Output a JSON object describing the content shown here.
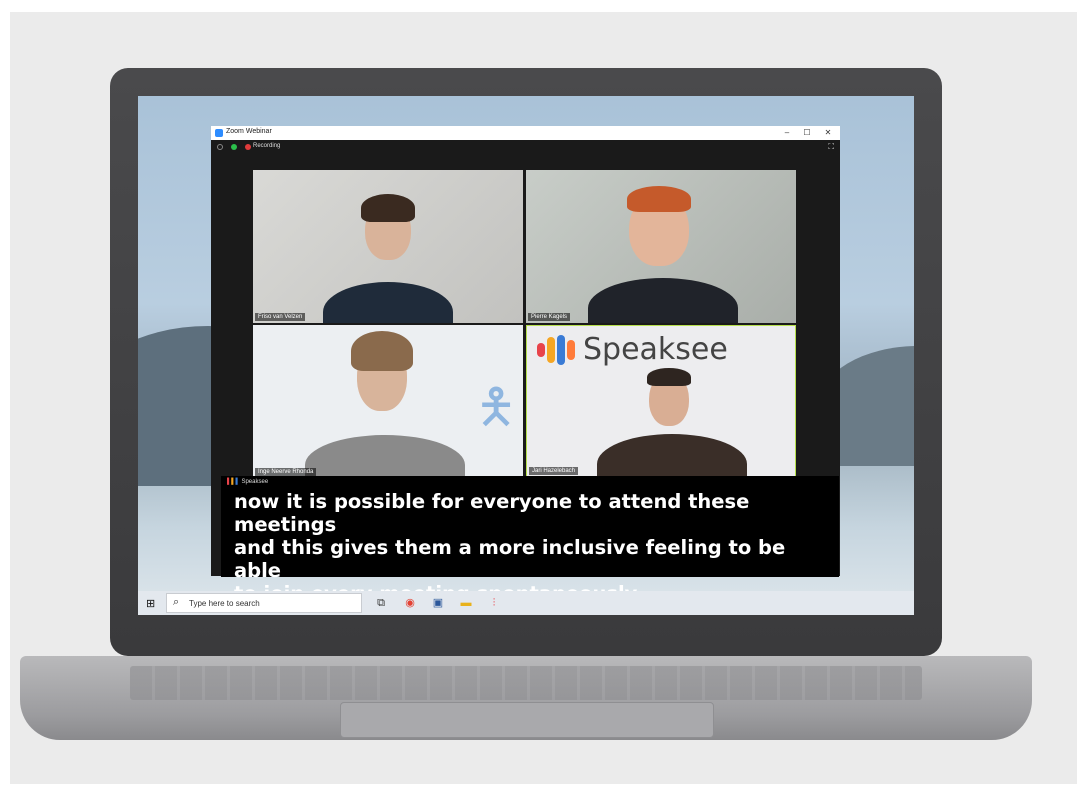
{
  "window": {
    "title": "Zoom Webinar",
    "minimize": "–",
    "maximize": "☐",
    "close": "✕",
    "recording_label": "Recording"
  },
  "participants": [
    {
      "name": "Friso van Velzen"
    },
    {
      "name": "Pierre Kagels"
    },
    {
      "name": "Inge Neerve Rhonda"
    },
    {
      "name": "Jari Hazelebach"
    }
  ],
  "tile_brand": {
    "text": "Speaksee"
  },
  "captions": {
    "brand": "Speaksee",
    "lines": [
      "now it is possible for everyone to attend these meetings",
      "and this gives them a more inclusive feeling to be able",
      "to join every meeting spontaneously"
    ]
  },
  "taskbar": {
    "search_placeholder": "Type here to search"
  },
  "colors": {
    "speaksee_bars": [
      "#e8434a",
      "#f5a623",
      "#3a7bd5",
      "#ff7b3a"
    ],
    "active_speaker_border": "#b6e04c"
  }
}
